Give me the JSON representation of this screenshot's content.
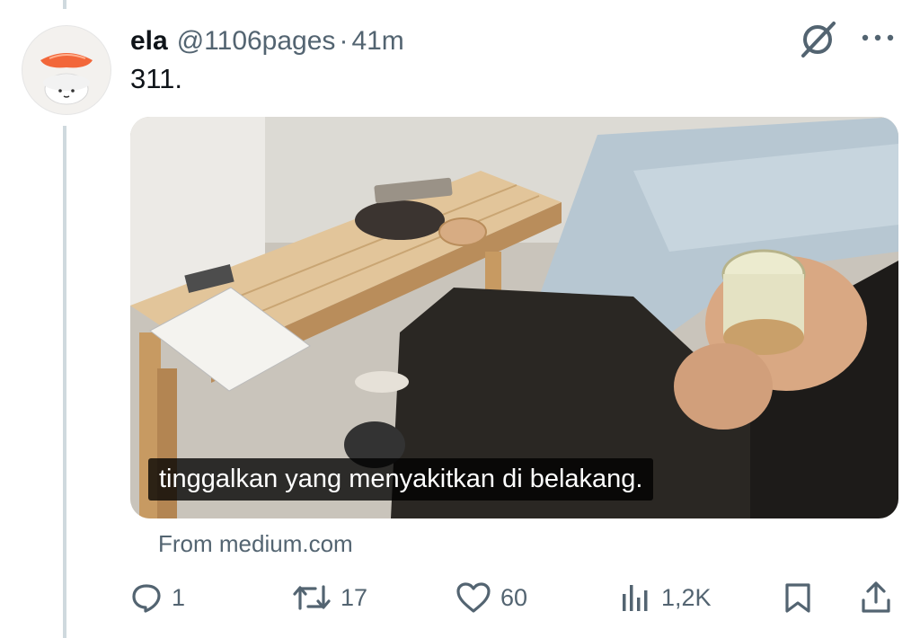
{
  "post": {
    "author_name": "ela",
    "author_handle": "@1106pages",
    "separator": "·",
    "time_ago": "41m",
    "text": "311.",
    "media": {
      "caption": "tinggalkan yang menyakitkan di belakang."
    },
    "source": "From medium.com"
  },
  "actions": {
    "replies": "1",
    "reposts": "17",
    "likes": "60",
    "views": "1,2K"
  },
  "icons": {
    "grok": "grok-icon",
    "more": "more-icon",
    "reply": "reply-icon",
    "repost": "repost-icon",
    "like": "heart-icon",
    "views": "analytics-icon",
    "bookmark": "bookmark-icon",
    "share": "share-icon"
  },
  "colors": {
    "text_primary": "#0f1419",
    "text_secondary": "#536471",
    "thread_line": "#cfd9de"
  }
}
